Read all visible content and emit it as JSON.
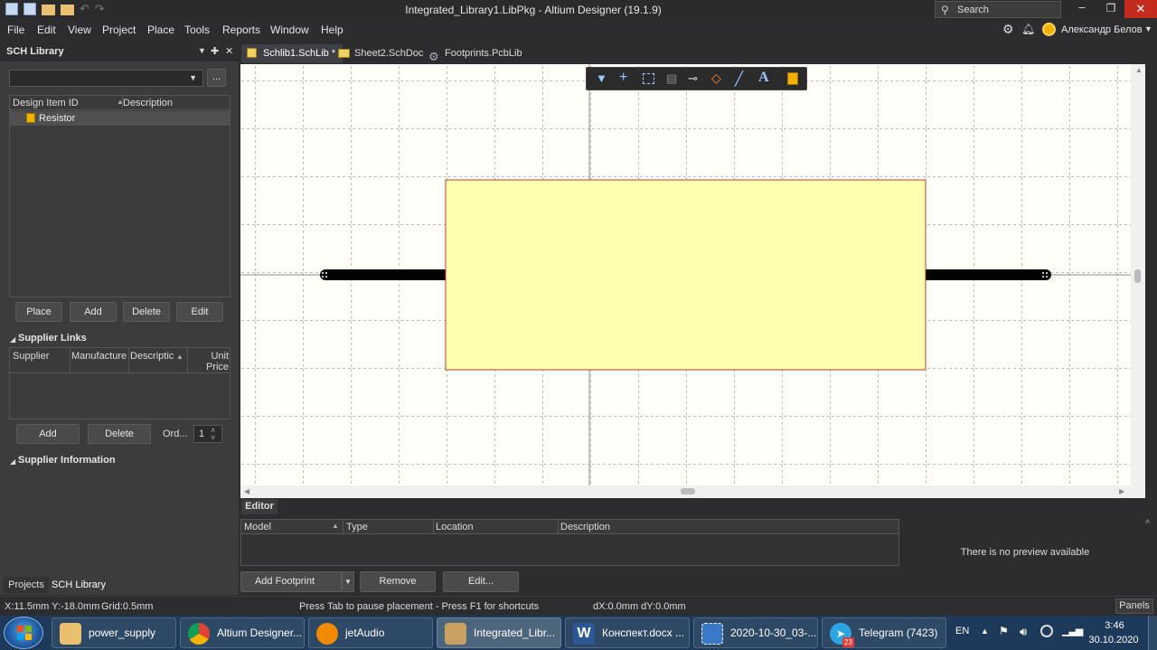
{
  "window": {
    "title": "Integrated_Library1.LibPkg - Altium Designer (19.1.9)",
    "search_label": "Search",
    "user": "Александр Белов"
  },
  "menu": [
    "File",
    "Edit",
    "View",
    "Project",
    "Place",
    "Tools",
    "Reports",
    "Window",
    "Help"
  ],
  "left_panel": {
    "title": "SCH Library",
    "more_button": "...",
    "columns": {
      "id": "Design Item ID",
      "desc": "Description"
    },
    "items": [
      {
        "id": "Resistor",
        "desc": ""
      }
    ],
    "buttons": {
      "place": "Place",
      "add": "Add",
      "delete": "Delete",
      "edit": "Edit"
    },
    "supplier_links": {
      "title": "Supplier Links",
      "columns": [
        "Supplier",
        "Manufacture",
        "Descriptic",
        "Unit Price"
      ],
      "buttons": {
        "add": "Add",
        "delete": "Delete"
      },
      "order_label": "Ord...",
      "order_value": "1"
    },
    "supplier_info_title": "Supplier Information",
    "bottom_tabs": [
      "Projects",
      "SCH Library"
    ]
  },
  "doc_tabs": [
    "Schlib1.SchLib *",
    "Sheet2.SchDoc",
    "Footprints.PcbLib"
  ],
  "editor": {
    "tab": "Editor",
    "columns": [
      "Model",
      "Type",
      "Location",
      "Description"
    ],
    "preview_text": "There is no preview available",
    "buttons": {
      "add_footprint": "Add Footprint",
      "remove": "Remove",
      "edit": "Edit..."
    }
  },
  "status": {
    "coords": "X:11.5mm Y:-18.0mm",
    "grid": "Grid:0.5mm",
    "hint": "Press Tab to pause placement - Press F1 for shortcuts",
    "delta": "dX:0.0mm dY:0.0mm",
    "panels": "Panels"
  },
  "taskbar": {
    "items": [
      "power_supply",
      "Altium Designer...",
      "jetAudio",
      "Integrated_Libr...",
      "Конспект.docx ...",
      "2020-10-30_03-...",
      "Telegram (7423)"
    ],
    "telegram_badge": "23",
    "lang": "EN",
    "time": "3:46",
    "date": "30.10.2020"
  },
  "colors": {
    "component_fill": "#ffffb0",
    "component_border": "#c0392b",
    "pin": "#000000",
    "accent": "#f0b400"
  }
}
